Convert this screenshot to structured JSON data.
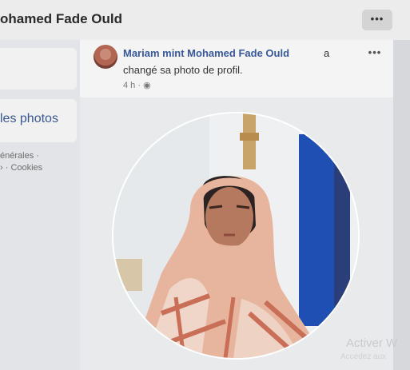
{
  "header": {
    "page_name": "ohamed Fade Ould",
    "more_label": "•••"
  },
  "sidebar": {
    "photos_link": "les photos",
    "footer_line1": "énérales ·",
    "footer_line2": "› · Cookies"
  },
  "post": {
    "author": "Mariam mint Mohamed Fade Ould",
    "action_part1": "a",
    "action_part2": "changé sa photo de profil.",
    "time": "4 h · ◉",
    "more_label": "•••"
  },
  "photo": {
    "subject": "profile-portrait"
  },
  "watermark": {
    "title": "Activer W",
    "subtitle": "Accédez aux"
  },
  "colors": {
    "link": "#385898",
    "background": "#dfe2e6"
  }
}
